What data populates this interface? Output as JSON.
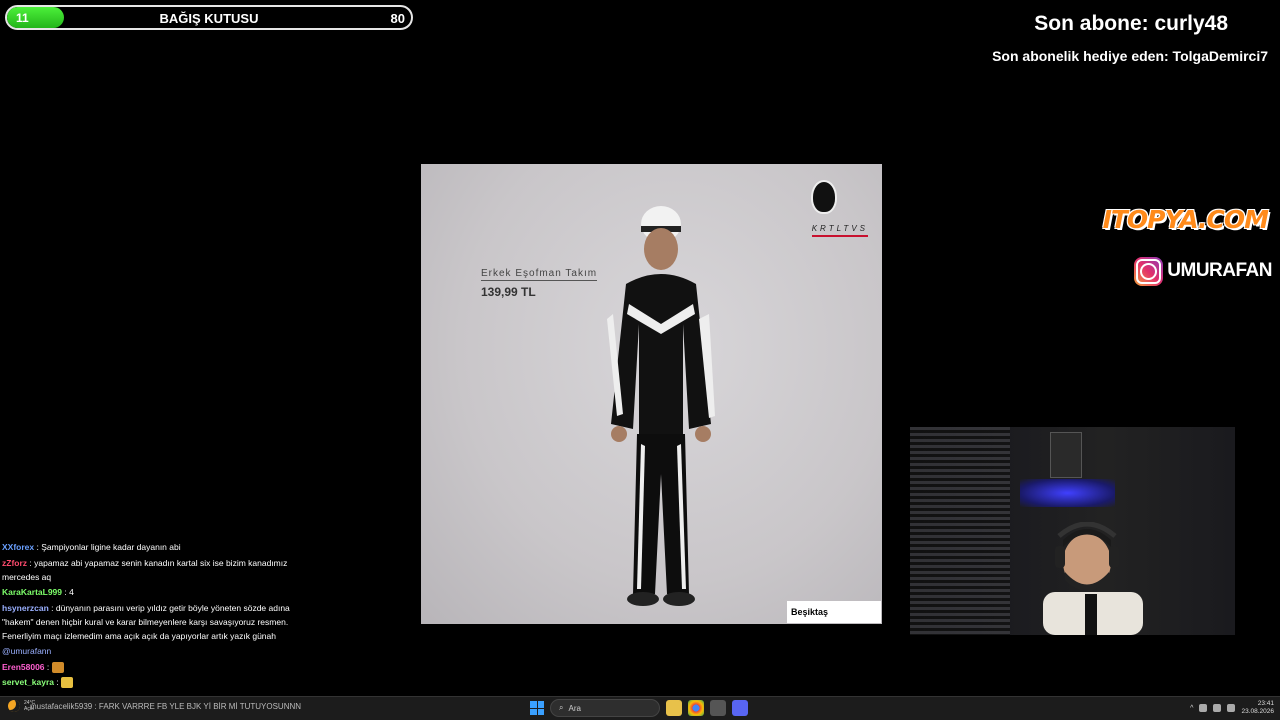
{
  "donation": {
    "current": "11",
    "title": "BAĞIŞ KUTUSU",
    "goal": "80",
    "progress_fraction": 0.14
  },
  "alerts": {
    "last_sub": "Son abone: curly48",
    "last_gift": "Son abonelik hediye eden: TolgaDemirci7"
  },
  "sponsor": {
    "name": "ITOPYA.COM",
    "instagram": "UMURAFAN"
  },
  "photo": {
    "product": "Erkek Eşofman Takım",
    "price": "139,99 TL",
    "brand": "KRTLTVS",
    "store": "Beşiktaş"
  },
  "chat": [
    {
      "user": "XXforex",
      "color": "#6aa0ff",
      "text": "Şampiyonlar ligine kadar dayanın abi"
    },
    {
      "user": "zZforz",
      "color": "#ff4b6e",
      "text": "yapamaz abi yapamaz senin kanadın kartal six ise bizim kanadımız mercedes aq"
    },
    {
      "user": "KaraKartaL999",
      "color": "#7dff6a",
      "text": "4"
    },
    {
      "user": "hsynerzcan",
      "color": "#9ab0ff",
      "text": "dünyanın parasını verip yıldız getir böyle yöneten sözde adına \"hakem\" denen hiçbir kural ve karar bilmeyenlere karşı savaşıyoruz resmen. Fenerliyim maçı izlemedim ama açık açık da yapıyorlar artık yazık günah"
    },
    {
      "user": "",
      "color": "#9ab0ff",
      "text": "@umurafann"
    },
    {
      "user": "Eren58006",
      "color": "#ff5fd0",
      "text": ""
    },
    {
      "user": "servet_kayra",
      "color": "#8aff7a",
      "text": ""
    }
  ],
  "taskbar": {
    "temp": "24°C",
    "weather": "Açık",
    "ticker": "mustafacelik5939 : FARK VARRRE FB YLE BJK Yİ BİR Mİ TUTUYOSUNNN",
    "search_placeholder": "Ara",
    "time": "23:41",
    "date": "23.08.2026"
  }
}
